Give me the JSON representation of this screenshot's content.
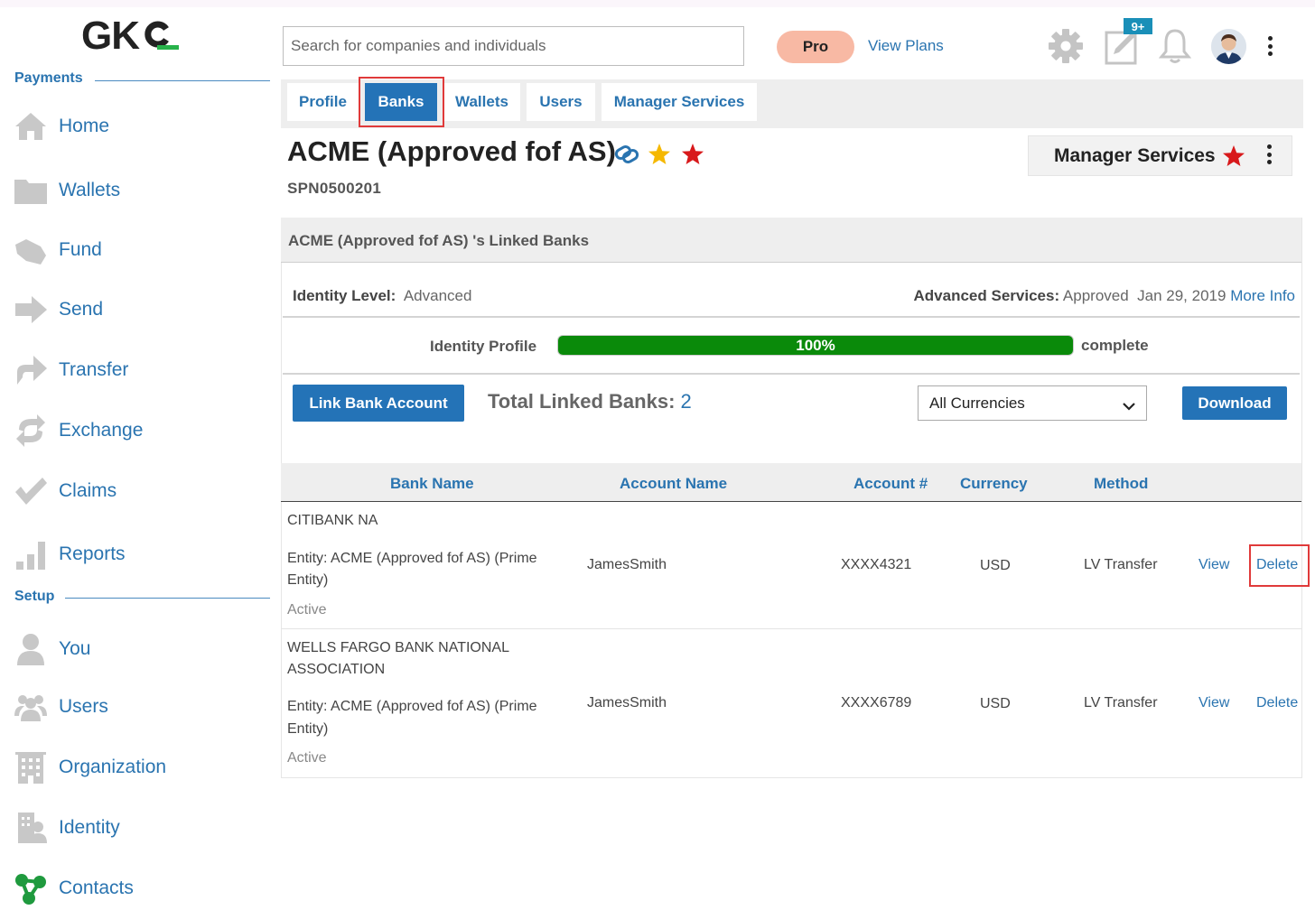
{
  "brand": {
    "logo_text": "GKC"
  },
  "sidebar": {
    "sections": [
      {
        "label": "Payments"
      },
      {
        "label": "Setup"
      }
    ],
    "payments_items": [
      {
        "label": "Home",
        "icon": "home-icon"
      },
      {
        "label": "Wallets",
        "icon": "folder-icon"
      },
      {
        "label": "Fund",
        "icon": "hand-money-icon"
      },
      {
        "label": "Send",
        "icon": "arrow-right-icon"
      },
      {
        "label": "Transfer",
        "icon": "share-arrow-icon"
      },
      {
        "label": "Exchange",
        "icon": "exchange-icon"
      },
      {
        "label": "Claims",
        "icon": "checkmark-icon"
      },
      {
        "label": "Reports",
        "icon": "bar-chart-icon"
      }
    ],
    "setup_items": [
      {
        "label": "You",
        "icon": "user-icon"
      },
      {
        "label": "Users",
        "icon": "users-icon"
      },
      {
        "label": "Organization",
        "icon": "building-icon"
      },
      {
        "label": "Identity",
        "icon": "identity-icon"
      },
      {
        "label": "Contacts",
        "icon": "contacts-network-icon"
      }
    ]
  },
  "header": {
    "search_placeholder": "Search for companies and individuals",
    "plan_badge": "Pro",
    "view_plans": "View Plans",
    "notification_badge": "9+"
  },
  "tabs": [
    {
      "label": "Profile",
      "active": false
    },
    {
      "label": "Banks",
      "active": true
    },
    {
      "label": "Wallets",
      "active": false
    },
    {
      "label": "Users",
      "active": false
    },
    {
      "label": "Manager Services",
      "active": false
    }
  ],
  "entity": {
    "name": "ACME (Approved fof AS)",
    "id": "SPN0500201",
    "manager_services_label": "Manager Services"
  },
  "panel": {
    "header": "ACME (Approved fof AS) 's Linked Banks",
    "identity_level_label": "Identity Level:",
    "identity_level_value": "Advanced",
    "advanced_services_label": "Advanced Services:",
    "advanced_services_status": "Approved",
    "advanced_services_date": "Jan 29, 2019",
    "more_info": "More Info",
    "identity_profile_label": "Identity Profile",
    "identity_profile_percent": "100%",
    "identity_profile_fraction": 1.0,
    "identity_profile_suffix": "complete",
    "link_bank_button": "Link Bank Account",
    "total_linked_label": "Total Linked Banks:",
    "total_linked_value": "2",
    "currency_filter": "All Currencies",
    "download_button": "Download"
  },
  "table": {
    "columns": [
      "Bank Name",
      "Account Name",
      "Account #",
      "Currency",
      "Method"
    ],
    "rows": [
      {
        "bank_name": "CITIBANK NA",
        "entity_line1": "Entity: ACME (Approved fof AS) (Prime",
        "entity_line2": "Entity)",
        "status": "Active",
        "account_name": "JamesSmith",
        "account_number": "XXXX4321",
        "currency": "USD",
        "method": "LV Transfer",
        "view": "View",
        "delete": "Delete"
      },
      {
        "bank_name_line1": "WELLS FARGO BANK NATIONAL",
        "bank_name_line2": "ASSOCIATION",
        "entity_line1": "Entity: ACME (Approved fof AS) (Prime",
        "entity_line2": "Entity)",
        "status": "Active",
        "account_name": "JamesSmith",
        "account_number": "XXXX6789",
        "currency": "USD",
        "method": "LV Transfer",
        "view": "View",
        "delete": "Delete"
      }
    ]
  },
  "colors": {
    "accent_blue": "#2473b7",
    "link_blue": "#2a74b0",
    "progress_green": "#0a8a0a",
    "highlight_red": "#e03a3a",
    "star_gold": "#f5b800",
    "star_red": "#d8191b"
  }
}
